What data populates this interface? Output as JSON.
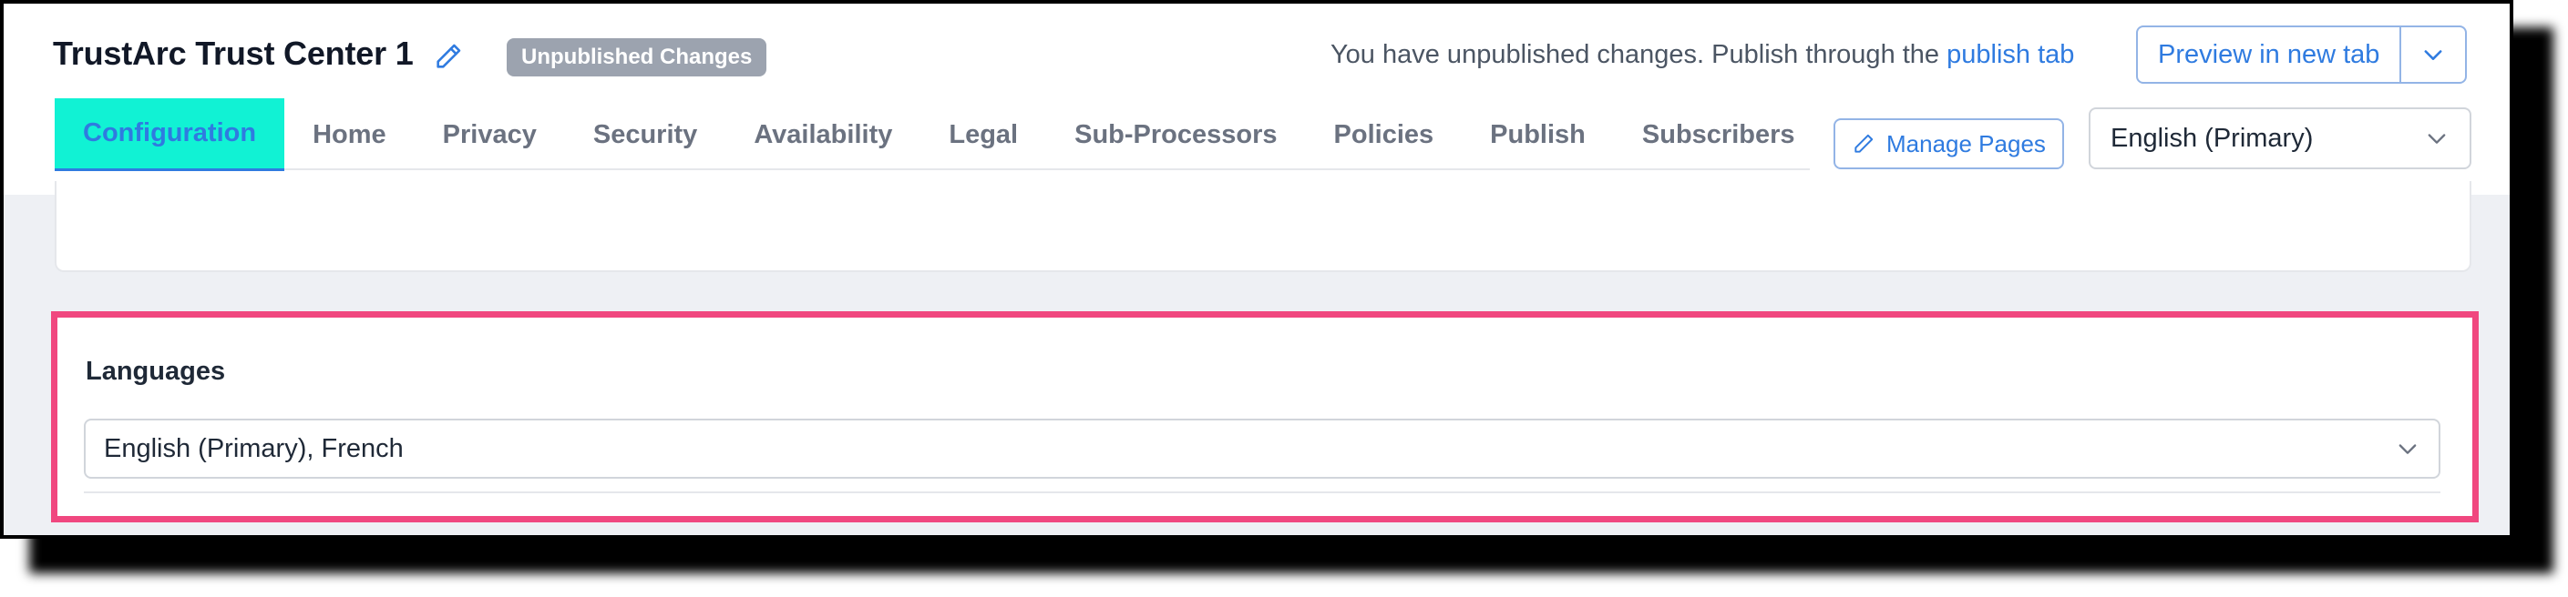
{
  "header": {
    "title": "TrustArc Trust Center 1",
    "badge": "Unpublished Changes",
    "notice_text": "You have unpublished changes. Publish through the",
    "notice_link": "publish tab",
    "preview_button": "Preview in new tab"
  },
  "tabs": [
    {
      "label": "Configuration",
      "active": true
    },
    {
      "label": "Home"
    },
    {
      "label": "Privacy"
    },
    {
      "label": "Security"
    },
    {
      "label": "Availability"
    },
    {
      "label": "Legal"
    },
    {
      "label": "Sub-Processors"
    },
    {
      "label": "Policies"
    },
    {
      "label": "Publish"
    },
    {
      "label": "Subscribers"
    }
  ],
  "manage_pages": "Manage Pages",
  "language_select": {
    "selected": "English (Primary)"
  },
  "languages_section": {
    "label": "Languages",
    "value": "English (Primary), French"
  },
  "colors": {
    "accent": "#2f7be0",
    "active_tab_bg": "#11f2d4",
    "badge_bg": "#9ca3af",
    "highlight_border": "#f0477f"
  },
  "icons": {
    "title_edit": "pencil-icon",
    "manage_pages": "pencil-icon",
    "dropdowns": "chevron-down-icon"
  }
}
